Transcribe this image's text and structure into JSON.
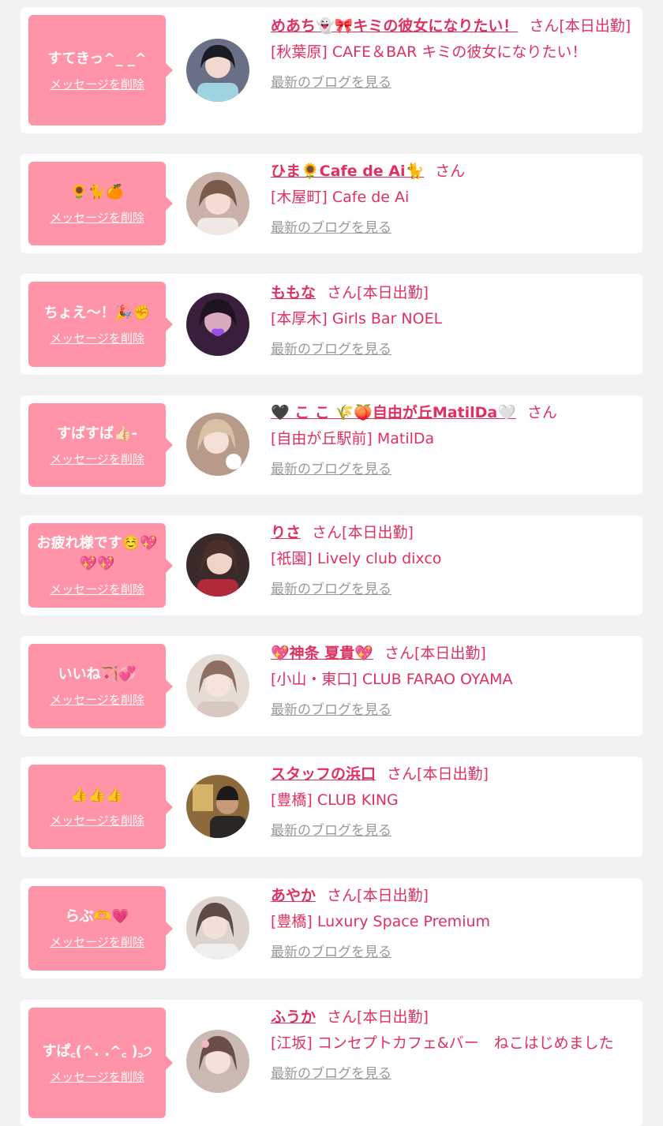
{
  "common": {
    "delete_label": "メッセージを削除",
    "san_label": "さん",
    "blog_label": "最新のブログを見る"
  },
  "colors": {
    "accent": "#e0305f",
    "bubble": "#ff94a8",
    "background": "#f2f2f2"
  },
  "items": [
    {
      "message": "すてきっ^_ _^",
      "name": "めあち👻🎀キミの彼女になりたい！",
      "status": "[本日出勤]",
      "shop": "[秋葉原] CAFE＆BAR キミの彼女になりたい！"
    },
    {
      "message": "🌻🐈🍊",
      "name": "ひま🌻Cafe de Ai🐈",
      "status": "",
      "shop": "[木屋町] Cafe de Ai"
    },
    {
      "message": "ちょえ〜！🎉✊",
      "name": "ももな",
      "status": "[本日出勤]",
      "shop": "[本厚木] Girls Bar NOEL"
    },
    {
      "message": "すばすば👍🏻-",
      "name": "🖤 こ こ 🌾🍑自由が丘MatilDa🤍",
      "status": "",
      "shop": "[自由が丘駅前] MatilDa"
    },
    {
      "message": "お疲れ様です☺️💖💖💖",
      "name": "りさ",
      "status": "[本日出勤]",
      "shop": "[祇園] Lively club dixco"
    },
    {
      "message": "いいね🏹💞",
      "name": "💖神条 夏貴💖",
      "status": "[本日出勤]",
      "shop": "[小山・東口] CLUB FARAO OYAMA"
    },
    {
      "message": "👍👍👍",
      "name": "スタッフの浜口",
      "status": "[本日出勤]",
      "shop": "[豊橋] CLUB KING"
    },
    {
      "message": "らぶ🫶💗",
      "name": "あやか",
      "status": "[本日出勤]",
      "shop": "[豊橋] Luxury Space Premium"
    },
    {
      "message": "すぱ꜀(^. .^꜀ )꜆੭",
      "name": "ふうか",
      "status": "[本日出勤]",
      "shop": "[江坂] コンセプトカフェ&バー　ねこはじめました"
    }
  ]
}
